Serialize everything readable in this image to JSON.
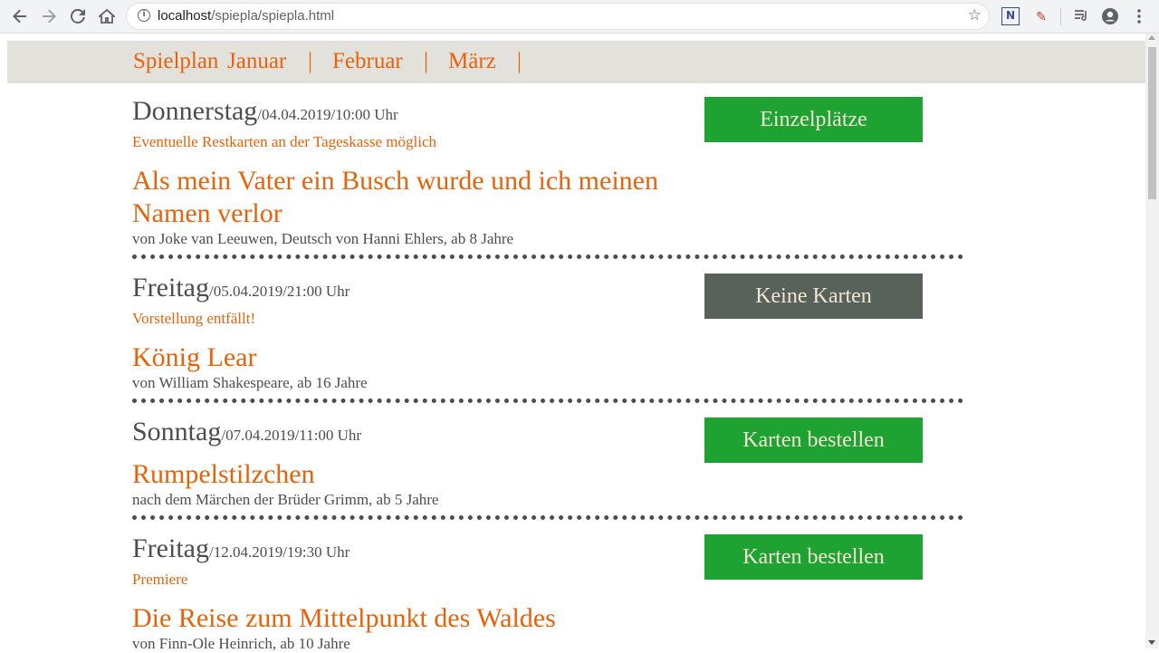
{
  "browser": {
    "url_host": "localhost",
    "url_path": "/spiepla/spiepla.html",
    "icons": [
      "back-icon",
      "forward-icon",
      "reload-icon",
      "home-icon",
      "info-icon",
      "star-icon",
      "extension-n-icon",
      "extension-pen-icon",
      "media-icon",
      "profile-icon",
      "menu-icon"
    ]
  },
  "nav": {
    "label": "Spielplan",
    "months": [
      "Januar",
      "Februar",
      "März"
    ],
    "sep": "|"
  },
  "entries": [
    {
      "day": "Donnerstag",
      "datetime": "/04.04.2019/10:00 Uhr",
      "note": "Eventuelle Restkarten an der Tageskasse möglich",
      "title": "Als mein Vater ein Busch wurde und ich meinen Namen verlor",
      "sub": "von Joke van Leeuwen, Deutsch von Hanni Ehlers, ab 8 Jahre",
      "button": "Einzelplätze",
      "button_color": "#1ea332"
    },
    {
      "day": "Freitag",
      "datetime": "/05.04.2019/21:00 Uhr",
      "note": "Vorstellung entfällt!",
      "title": "König Lear",
      "sub": "von William Shakespeare, ab 16 Jahre",
      "button": "Keine Karten",
      "button_color": "#59615b"
    },
    {
      "day": "Sonntag",
      "datetime": "/07.04.2019/11:00 Uhr",
      "note": "",
      "title": "Rumpelstilzchen",
      "sub": "nach dem Märchen der Brüder Grimm, ab 5 Jahre",
      "button": "Karten bestellen",
      "button_color": "#1ea332"
    },
    {
      "day": "Freitag",
      "datetime": "/12.04.2019/19:30 Uhr",
      "note": "Premiere",
      "title": "Die Reise zum Mittelpunkt des Waldes",
      "sub": "von Finn-Ole Heinrich, ab 10 Jahre",
      "button": "Karten bestellen",
      "button_color": "#1ea332"
    }
  ],
  "colors": {
    "accent": "#e8620a",
    "text": "#4a4f4b",
    "nav_bg": "#e3e1dc"
  }
}
